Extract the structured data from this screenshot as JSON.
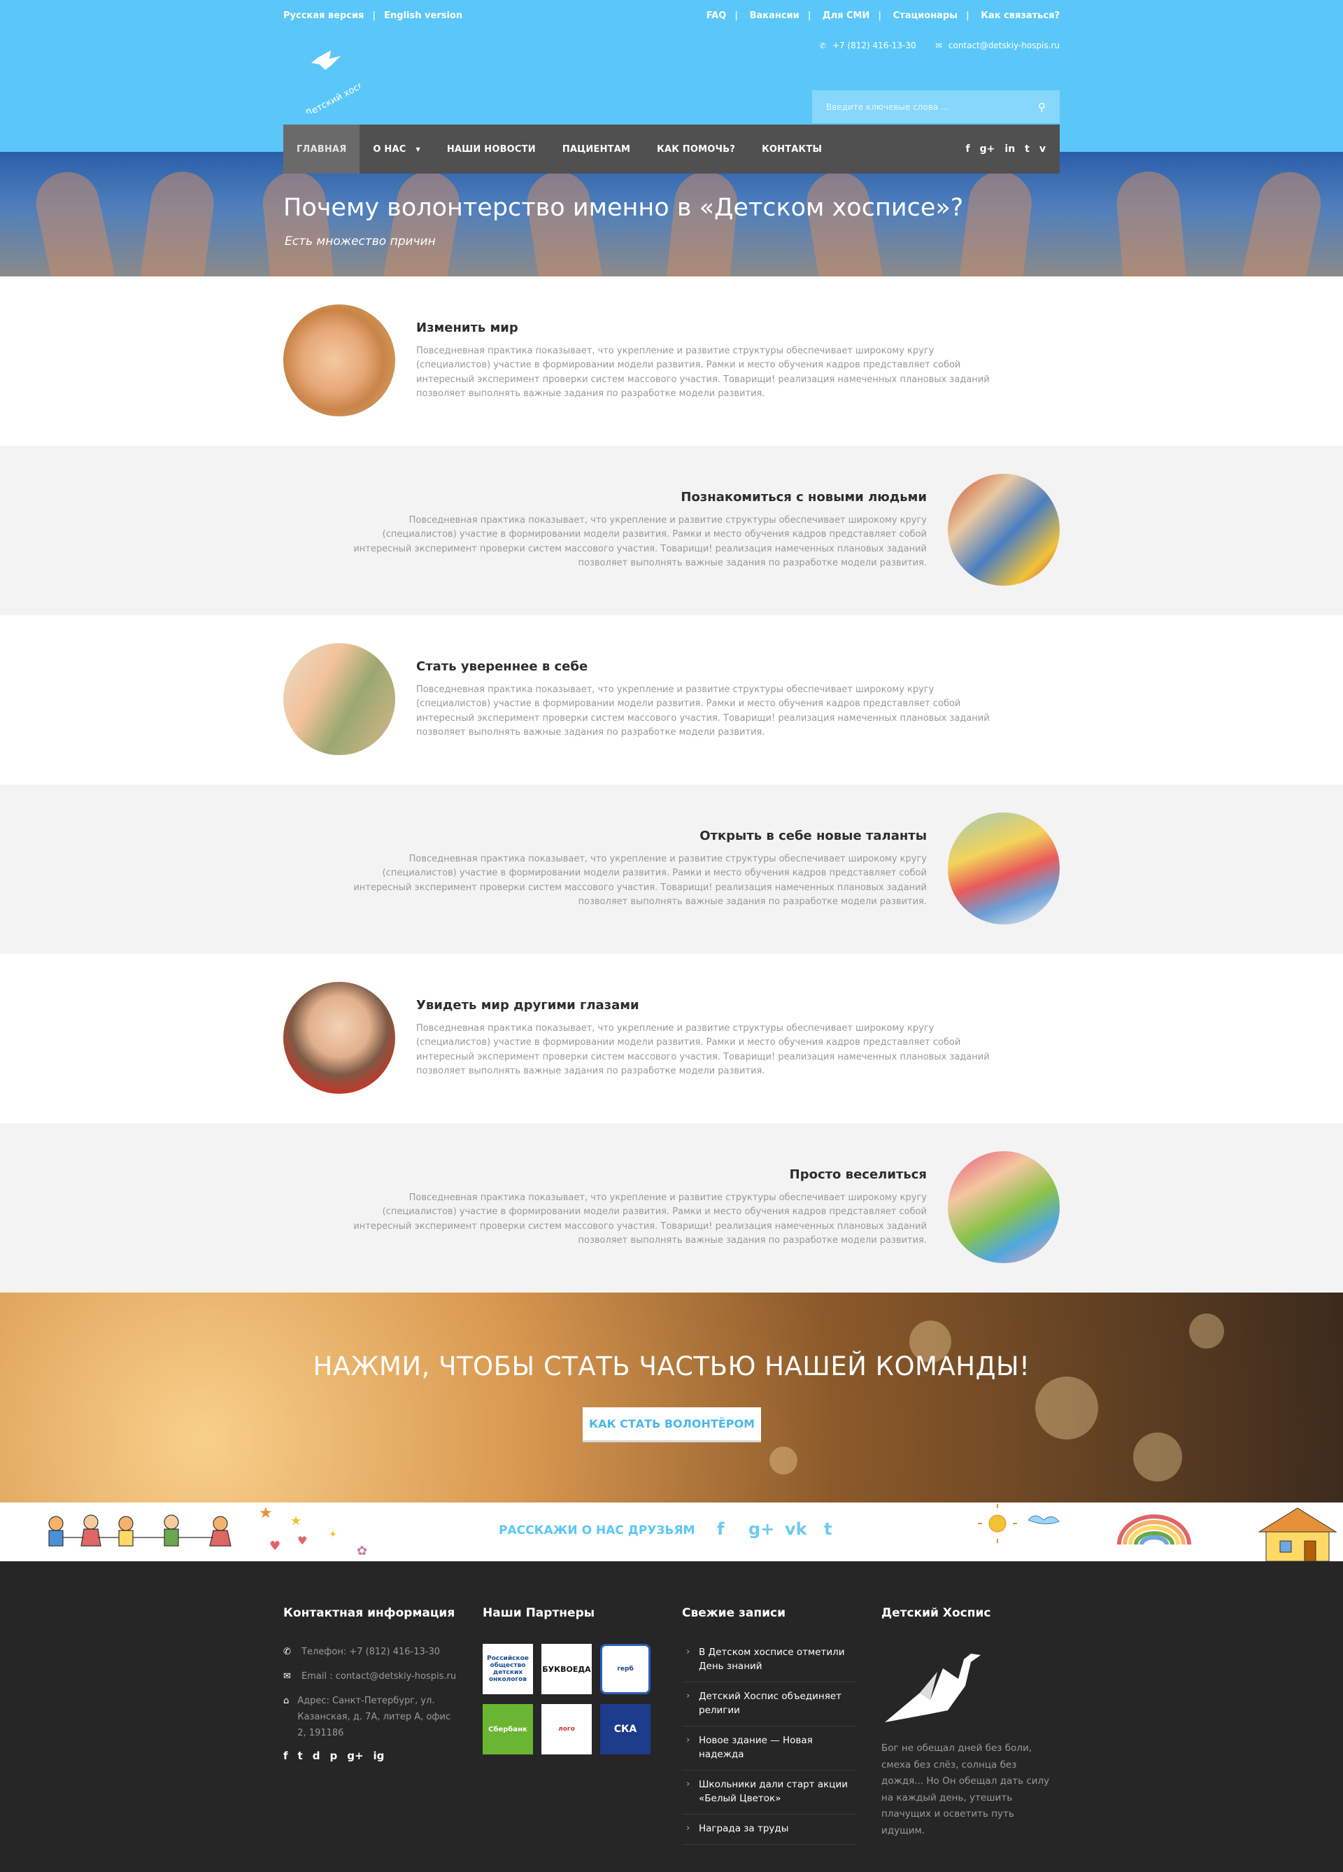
{
  "topbar": {
    "lang_ru": "Русская версия",
    "lang_en": "English version",
    "links": [
      "FAQ",
      "Вакансии",
      "Для СМИ",
      "Стационары",
      "Как связаться?"
    ]
  },
  "contacts": {
    "phone": "+7 (812) 416-13-30",
    "email": "contact@detskiy-hospis.ru"
  },
  "logo": {
    "text": "Детский хоспис"
  },
  "search": {
    "placeholder": "Введите ключевые слова ..."
  },
  "nav": {
    "items": [
      "ГЛАВНАЯ",
      "О НАС",
      "НАШИ НОВОСТИ",
      "ПАЦИЕНТАМ",
      "КАК ПОМОЧЬ?",
      "КОНТАКТЫ"
    ],
    "social": [
      "f",
      "g+",
      "in",
      "t",
      "v"
    ]
  },
  "hero": {
    "title": "Почему волонтерство именно в «Детском хосписе»?",
    "subtitle": "Есть множество причин"
  },
  "reasons": [
    {
      "title": "Изменить мир",
      "text": "Повседневная практика показывает, что укрепление и развитие структуры обеспечивает широкому кругу (специалистов) участие в формировании модели развития. Рамки и место обучения кадров представляет собой интересный эксперимент проверки систем массового участия. Товарищи! реализация намеченных плановых заданий позволяет выполнять важные задания по разработке модели развития."
    },
    {
      "title": "Познакомиться с новыми людьми",
      "text": "Повседневная практика показывает, что укрепление и развитие структуры обеспечивает широкому кругу (специалистов) участие в формировании модели развития. Рамки и место обучения кадров представляет собой интересный эксперимент проверки систем массового участия. Товарищи! реализация намеченных плановых заданий позволяет выполнять важные задания по разработке модели развития."
    },
    {
      "title": "Стать увереннее в себе",
      "text": "Повседневная практика показывает, что укрепление и развитие структуры обеспечивает широкому кругу (специалистов) участие в формировании модели развития. Рамки и место обучения кадров представляет собой интересный эксперимент проверки систем массового участия. Товарищи! реализация намеченных плановых заданий позволяет выполнять важные задания по разработке модели развития."
    },
    {
      "title": "Открыть в себе новые таланты",
      "text": "Повседневная практика показывает, что укрепление и развитие структуры обеспечивает широкому кругу (специалистов) участие в формировании модели развития. Рамки и место обучения кадров представляет собой интересный эксперимент проверки систем массового участия. Товарищи! реализация намеченных плановых заданий позволяет выполнять важные задания по разработке модели развития."
    },
    {
      "title": "Увидеть мир другими глазами",
      "text": "Повседневная практика показывает, что укрепление и развитие структуры обеспечивает широкому кругу (специалистов) участие в формировании модели развития. Рамки и место обучения кадров представляет собой интересный эксперимент проверки систем массового участия. Товарищи! реализация намеченных плановых заданий позволяет выполнять важные задания по разработке модели развития."
    },
    {
      "title": "Просто веселиться",
      "text": "Повседневная практика показывает, что укрепление и развитие структуры обеспечивает широкому кругу (специалистов) участие в формировании модели развития. Рамки и место обучения кадров представляет собой интересный эксперимент проверки систем массового участия. Товарищи! реализация намеченных плановых заданий позволяет выполнять важные задания по разработке модели развития."
    }
  ],
  "cta": {
    "title": "НАЖМИ, ЧТОБЫ СТАТЬ ЧАСТЬЮ НАШЕЙ КОМАНДЫ!",
    "button": "КАК СТАТЬ ВОЛОНТЁРОМ"
  },
  "share": {
    "label": "РАССКАЖИ О НАС ДРУЗЬЯМ",
    "icons": [
      "f",
      "g+",
      "vk",
      "t"
    ]
  },
  "footer": {
    "contact": {
      "title": "Контактная информация",
      "phone": "Телефон: +7 (812) 416-13-30",
      "email": "Email : contact@detskiy-hospis.ru",
      "address": "Адрес: Санкт-Петербург, ул. Казанская, д. 7А, литер А, офис 2, 191186",
      "social": [
        "f",
        "t",
        "d",
        "p",
        "g+",
        "ig"
      ]
    },
    "partners": {
      "title": "Наши Партнеры",
      "items": [
        "Российское общество детских онкологов",
        "БУКВОЕДА",
        "герб",
        "Сбербанк",
        "лого",
        "СКА"
      ]
    },
    "posts": {
      "title": "Свежие записи",
      "items": [
        "В Детском хосписе отметили День знаний",
        "Детский Хоспис объединяет религии",
        "Новое здание — Новая надежда",
        "Школьники дали старт акции «Белый Цветок»",
        "Награда за труды"
      ]
    },
    "about": {
      "title": "Детский Хоспис",
      "quote": "Бог не обещал дней без боли, смеха без слёз, солнца без дождя... Но Он обещал дать силу на каждый день, утешить плачущих и осветить путь идущим."
    }
  },
  "colors": {
    "accent": "#5bc7f8",
    "nav": "#505050",
    "footer": "#262626"
  }
}
